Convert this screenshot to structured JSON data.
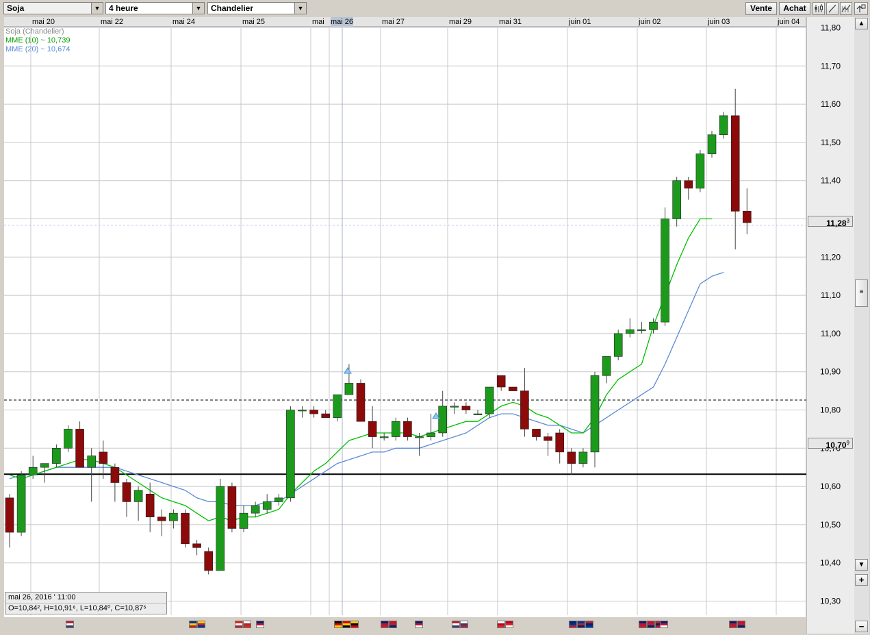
{
  "toolbar": {
    "instrument": "Soja",
    "period": "4 heure",
    "chart_type": "Chandelier",
    "sell_label": "Vente",
    "buy_label": "Achat"
  },
  "legend": {
    "title": "Soja (Chandelier)",
    "ema10": "MME (10) ~ 10,739",
    "ema20": "MME (20) ~ 10,674",
    "ema10_color": "#00c000",
    "ema20_color": "#5a8ad8"
  },
  "info": {
    "date": "mai 26, 2016 ' 11:00",
    "ohlc": "O=10,84², H=10,91⁶, L=10,84⁰, C=10,87⁵"
  },
  "price_boxes": {
    "current": "11,28",
    "current_sup": "3",
    "level": "10,70",
    "level_sup": "9"
  },
  "colors": {
    "up": "#1c9a1c",
    "down": "#8c0a0a",
    "grid": "#c8c8c8",
    "support_line": "#000000"
  },
  "flags": [
    "us",
    "eu-us",
    "ch-us",
    "au",
    "de-ch-ca",
    "gb-us",
    "gb",
    "us-us",
    "jp-ca",
    "au-eu-us",
    "au-gb-us",
    "au",
    "gb-us",
    "gb-us"
  ],
  "chart_data": {
    "type": "candlestick",
    "title": "Soja (Chandelier)",
    "ylim": [
      10.25,
      11.82
    ],
    "y_ticks": [
      "11,80",
      "11,70",
      "11,60",
      "11,50",
      "11,40",
      "11,30",
      "11,20",
      "11,10",
      "11,00",
      "10,90",
      "10,80",
      "10,70",
      "10,60",
      "10,50",
      "10,40",
      "10,30"
    ],
    "date_labels": [
      "mai 20",
      "mai 22",
      "mai 24",
      "mai 25",
      "mai",
      "mai 26",
      "mai 27",
      "mai 29",
      "mai 31",
      "juin 01",
      "juin 02",
      "juin 03",
      "juin 04"
    ],
    "horizontal_lines": [
      {
        "value": 10.632,
        "style": "solid"
      },
      {
        "value": 10.826,
        "style": "dashed"
      },
      {
        "value": 11.283,
        "style": "dotted"
      }
    ],
    "candles": [
      [
        10.57,
        10.58,
        10.44,
        10.48
      ],
      [
        10.48,
        10.64,
        10.47,
        10.63
      ],
      [
        10.63,
        10.68,
        10.62,
        10.65
      ],
      [
        10.65,
        10.66,
        10.61,
        10.66
      ],
      [
        10.66,
        10.71,
        10.65,
        10.7
      ],
      [
        10.7,
        10.76,
        10.69,
        10.75
      ],
      [
        10.75,
        10.77,
        10.65,
        10.65
      ],
      [
        10.65,
        10.7,
        10.56,
        10.68
      ],
      [
        10.69,
        10.72,
        10.62,
        10.66
      ],
      [
        10.65,
        10.66,
        10.56,
        10.61
      ],
      [
        10.61,
        10.62,
        10.52,
        10.56
      ],
      [
        10.56,
        10.6,
        10.51,
        10.59
      ],
      [
        10.58,
        10.61,
        10.48,
        10.52
      ],
      [
        10.52,
        10.54,
        10.47,
        10.51
      ],
      [
        10.51,
        10.54,
        10.49,
        10.53
      ],
      [
        10.53,
        10.54,
        10.44,
        10.45
      ],
      [
        10.45,
        10.46,
        10.42,
        10.44
      ],
      [
        10.43,
        10.44,
        10.37,
        10.38
      ],
      [
        10.38,
        10.62,
        10.38,
        10.6
      ],
      [
        10.6,
        10.61,
        10.48,
        10.49
      ],
      [
        10.49,
        10.55,
        10.48,
        10.53
      ],
      [
        10.53,
        10.56,
        10.52,
        10.55
      ],
      [
        10.54,
        10.58,
        10.53,
        10.56
      ],
      [
        10.56,
        10.58,
        10.55,
        10.57
      ],
      [
        10.57,
        10.81,
        10.56,
        10.8
      ],
      [
        10.8,
        10.81,
        10.78,
        10.8
      ],
      [
        10.8,
        10.81,
        10.78,
        10.79
      ],
      [
        10.79,
        10.8,
        10.78,
        10.78
      ],
      [
        10.78,
        10.84,
        10.77,
        10.84
      ],
      [
        10.84,
        10.92,
        10.84,
        10.87
      ],
      [
        10.87,
        10.88,
        10.78,
        10.77
      ],
      [
        10.77,
        10.81,
        10.7,
        10.73
      ],
      [
        10.73,
        10.74,
        10.72,
        10.73
      ],
      [
        10.73,
        10.78,
        10.72,
        10.77
      ],
      [
        10.77,
        10.78,
        10.72,
        10.73
      ],
      [
        10.73,
        10.74,
        10.68,
        10.73
      ],
      [
        10.73,
        10.79,
        10.72,
        10.74
      ],
      [
        10.74,
        10.85,
        10.73,
        10.81
      ],
      [
        10.81,
        10.82,
        10.79,
        10.81
      ],
      [
        10.81,
        10.82,
        10.79,
        10.8
      ],
      [
        10.79,
        10.8,
        10.79,
        10.79
      ],
      [
        10.79,
        10.86,
        10.78,
        10.86
      ],
      [
        10.89,
        10.89,
        10.85,
        10.86
      ],
      [
        10.86,
        10.86,
        10.85,
        10.85
      ],
      [
        10.85,
        10.91,
        10.73,
        10.75
      ],
      [
        10.75,
        10.75,
        10.72,
        10.73
      ],
      [
        10.73,
        10.74,
        10.68,
        10.72
      ],
      [
        10.74,
        10.75,
        10.66,
        10.69
      ],
      [
        10.69,
        10.7,
        10.63,
        10.66
      ],
      [
        10.66,
        10.7,
        10.65,
        10.69
      ],
      [
        10.69,
        10.9,
        10.65,
        10.89
      ],
      [
        10.89,
        10.94,
        10.87,
        10.94
      ],
      [
        10.94,
        11.01,
        10.93,
        11.0
      ],
      [
        11.0,
        11.04,
        10.99,
        11.01
      ],
      [
        11.01,
        11.03,
        11.0,
        11.01
      ],
      [
        11.01,
        11.04,
        11.0,
        11.03
      ],
      [
        11.03,
        11.33,
        11.02,
        11.3
      ],
      [
        11.3,
        11.41,
        11.28,
        11.4
      ],
      [
        11.4,
        11.41,
        11.35,
        11.38
      ],
      [
        11.38,
        11.48,
        11.37,
        11.47
      ],
      [
        11.47,
        11.53,
        11.46,
        11.52
      ],
      [
        11.52,
        11.58,
        11.51,
        11.57
      ],
      [
        11.57,
        11.64,
        11.22,
        11.32
      ],
      [
        11.32,
        11.38,
        11.26,
        11.29
      ]
    ],
    "ema10": [
      10.63,
      10.62,
      10.63,
      10.64,
      10.65,
      10.66,
      10.67,
      10.67,
      10.66,
      10.65,
      10.63,
      10.61,
      10.59,
      10.57,
      10.56,
      10.55,
      10.53,
      10.51,
      10.52,
      10.51,
      10.52,
      10.52,
      10.53,
      10.54,
      10.58,
      10.61,
      10.64,
      10.66,
      10.69,
      10.72,
      10.73,
      10.74,
      10.74,
      10.74,
      10.74,
      10.73,
      10.74,
      10.75,
      10.76,
      10.77,
      10.77,
      10.79,
      10.81,
      10.82,
      10.81,
      10.79,
      10.78,
      10.76,
      10.74,
      10.74,
      10.78,
      10.84,
      10.88,
      10.9,
      10.92,
      11.02,
      11.1,
      11.18,
      11.25,
      11.3,
      11.3
    ],
    "ema20": [
      10.62,
      10.63,
      10.63,
      10.64,
      10.65,
      10.65,
      10.65,
      10.65,
      10.65,
      10.65,
      10.64,
      10.63,
      10.62,
      10.61,
      10.6,
      10.59,
      10.57,
      10.56,
      10.56,
      10.55,
      10.55,
      10.55,
      10.56,
      10.56,
      10.58,
      10.6,
      10.62,
      10.64,
      10.66,
      10.67,
      10.68,
      10.69,
      10.69,
      10.7,
      10.7,
      10.7,
      10.71,
      10.72,
      10.73,
      10.74,
      10.76,
      10.78,
      10.79,
      10.79,
      10.78,
      10.77,
      10.76,
      10.76,
      10.75,
      10.74,
      10.76,
      10.78,
      10.8,
      10.82,
      10.84,
      10.86,
      10.92,
      10.99,
      11.06,
      11.13,
      11.15,
      11.16
    ]
  }
}
